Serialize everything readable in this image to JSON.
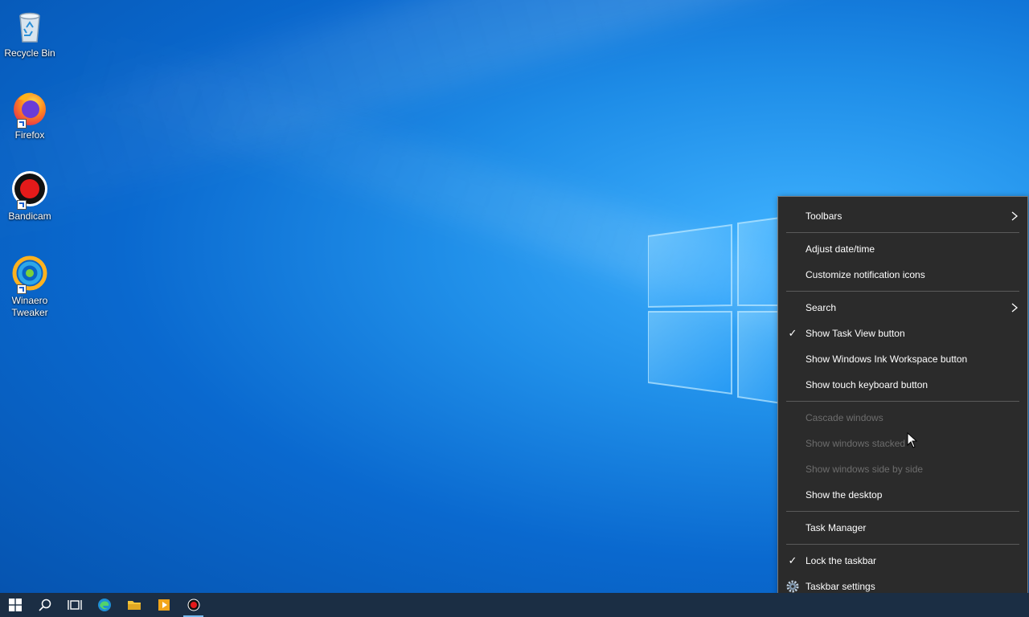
{
  "desktop": {
    "icons": [
      {
        "label": "Recycle Bin"
      },
      {
        "label": "Firefox"
      },
      {
        "label": "Bandicam"
      },
      {
        "label": "Winaero\nTweaker"
      }
    ]
  },
  "context_menu": {
    "items": [
      {
        "label": "Toolbars"
      },
      {
        "label": "Adjust date/time"
      },
      {
        "label": "Customize notification icons"
      },
      {
        "label": "Search"
      },
      {
        "label": "Show Task View button",
        "checked": true
      },
      {
        "label": "Show Windows Ink Workspace button"
      },
      {
        "label": "Show touch keyboard button"
      },
      {
        "label": "Cascade windows",
        "disabled": true
      },
      {
        "label": "Show windows stacked",
        "disabled": true
      },
      {
        "label": "Show windows side by side",
        "disabled": true
      },
      {
        "label": "Show the desktop"
      },
      {
        "label": "Task Manager"
      },
      {
        "label": "Lock the taskbar",
        "checked": true
      },
      {
        "label": "Taskbar settings"
      }
    ],
    "check_glyph": "✓"
  },
  "taskbar": {
    "buttons": [
      "start-icon",
      "search-icon",
      "task-view-icon",
      "edge-icon",
      "file-explorer-icon",
      "media-player-icon",
      "bandicam-icon"
    ]
  },
  "colors": {
    "menu_bg": "#2b2b2b",
    "menu_disabled_text": "#6d6d6d",
    "taskbar_bg": "#1b2e44"
  }
}
